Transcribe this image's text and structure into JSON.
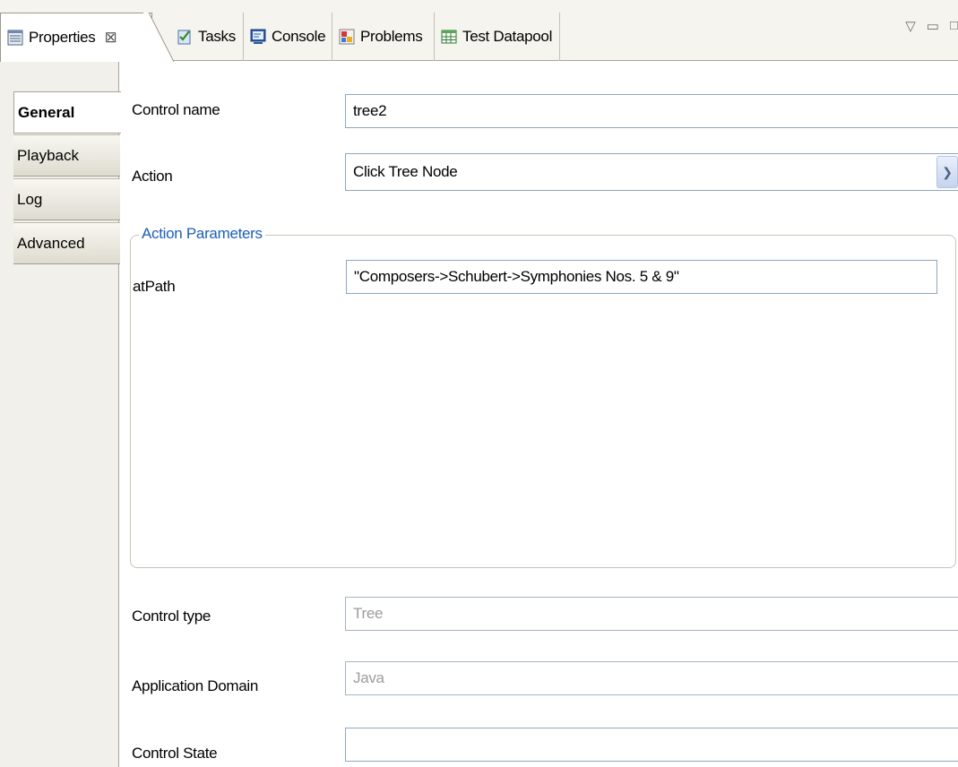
{
  "tabs": [
    {
      "label": "Properties",
      "icon": "properties-icon",
      "active": true,
      "closable": true
    },
    {
      "label": "Tasks",
      "icon": "tasks-icon"
    },
    {
      "label": "Console",
      "icon": "console-icon"
    },
    {
      "label": "Problems",
      "icon": "problems-icon"
    },
    {
      "label": "Test Datapool",
      "icon": "datapool-icon"
    }
  ],
  "view_controls": {
    "menu_glyph": "▽",
    "minimize_glyph": "▭",
    "maximize_glyph": "□"
  },
  "sections": [
    {
      "label": "General",
      "active": true
    },
    {
      "label": "Playback"
    },
    {
      "label": "Log"
    },
    {
      "label": "Advanced"
    }
  ],
  "form": {
    "control_name": {
      "label": "Control name",
      "value": "tree2"
    },
    "action": {
      "label": "Action",
      "value": "Click Tree Node"
    },
    "action_parameters": {
      "title": "Action Parameters",
      "at_path": {
        "label": "atPath",
        "value": "\"Composers->Schubert->Symphonies Nos. 5 & 9\""
      }
    },
    "control_type": {
      "label": "Control type",
      "value": "Tree"
    },
    "application_domain": {
      "label": "Application Domain",
      "value": "Java"
    },
    "control_state": {
      "label": "Control State",
      "value": ""
    }
  },
  "colors": {
    "accent_blue": "#1d5fb6",
    "field_border": "#8ea6c2",
    "disabled_text": "#9c9c9c"
  }
}
